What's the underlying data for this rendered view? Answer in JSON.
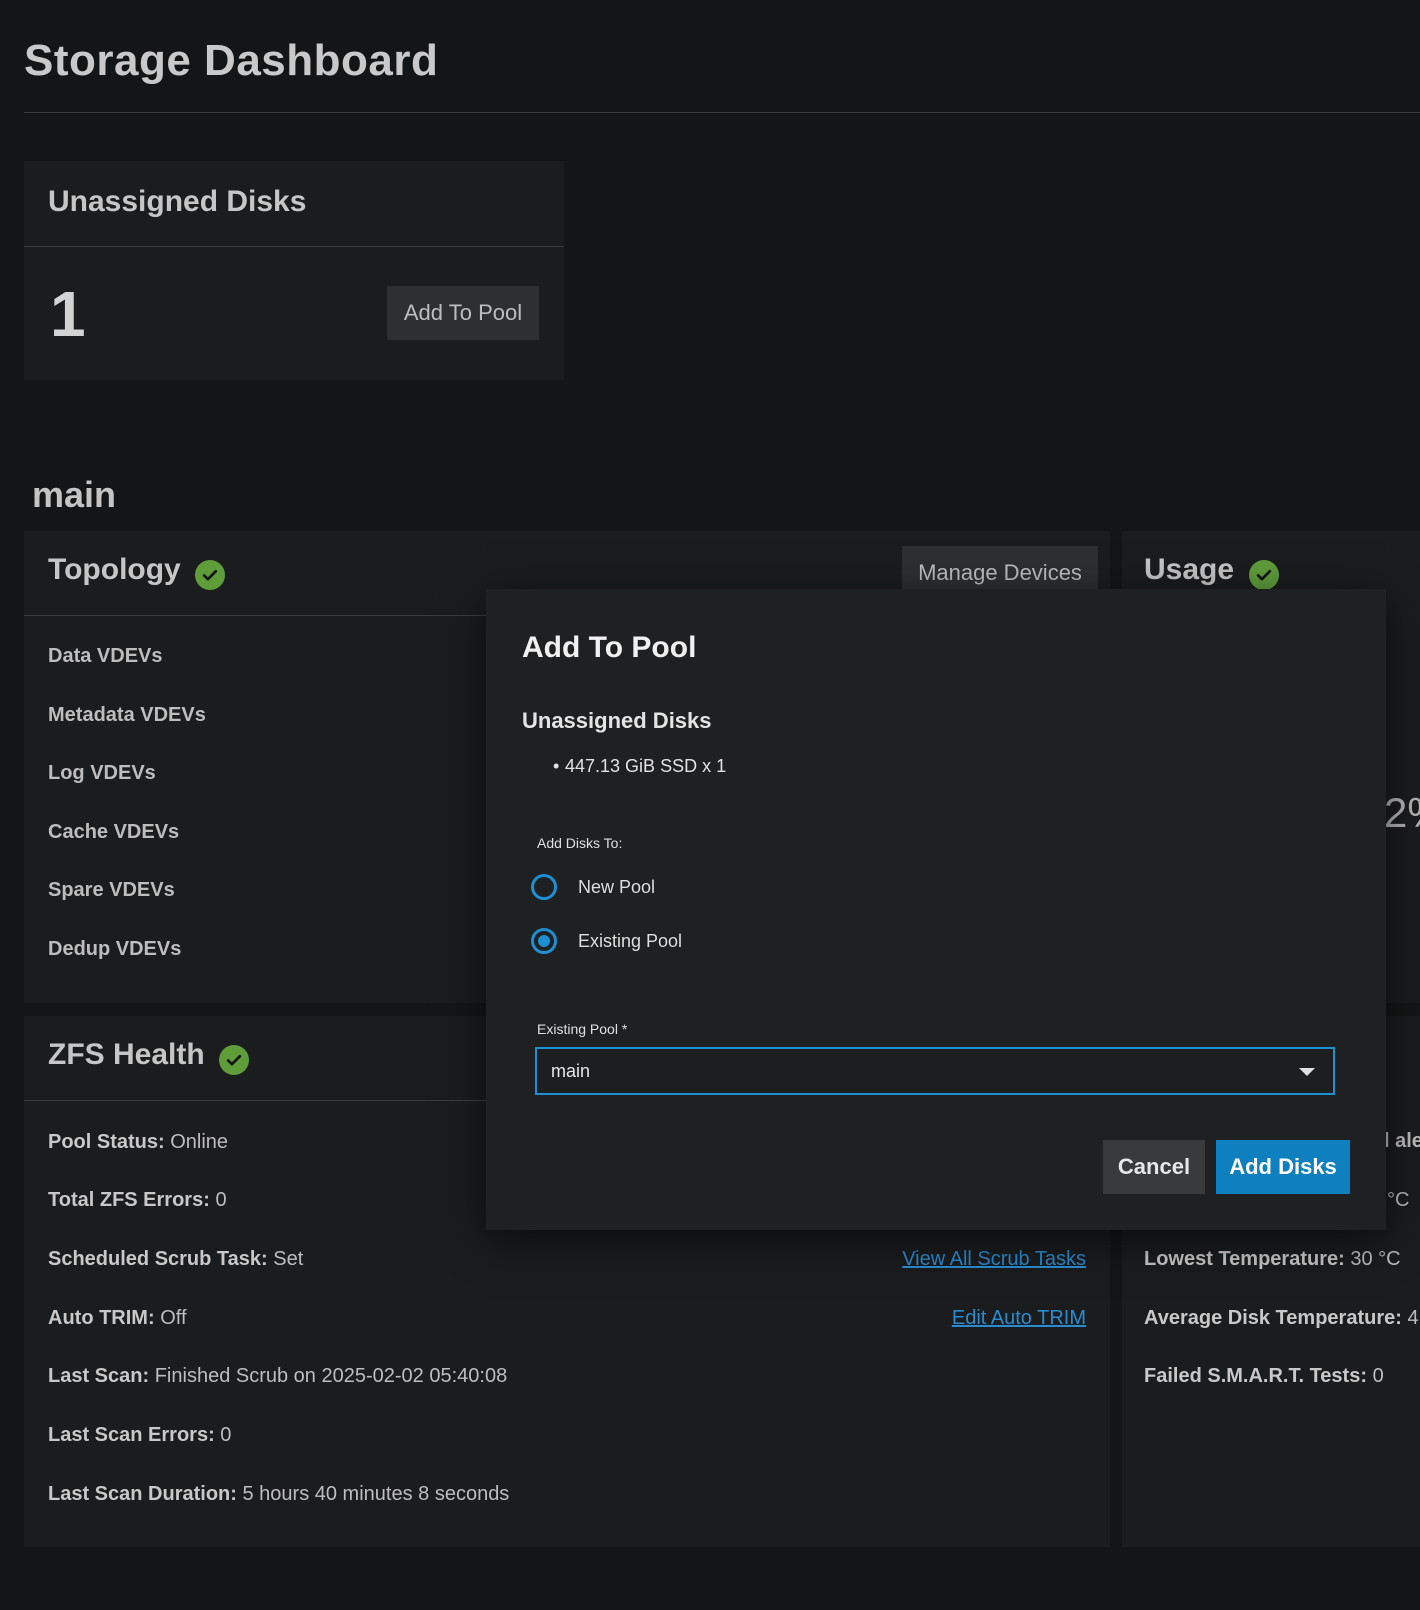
{
  "page": {
    "title": "Storage Dashboard"
  },
  "unassigned": {
    "title": "Unassigned Disks",
    "count": "1",
    "add_button": "Add To Pool"
  },
  "pool": {
    "name": "main"
  },
  "topology": {
    "title": "Topology",
    "manage_button": "Manage Devices",
    "rows": [
      "Data VDEVs",
      "Metadata VDEVs",
      "Log VDEVs",
      "Cache VDEVs",
      "Spare VDEVs",
      "Dedup VDEVs"
    ]
  },
  "usage": {
    "title": "Usage",
    "partial_value": "2%"
  },
  "zfs_health": {
    "title": "ZFS Health",
    "rows": [
      {
        "label": "Pool Status:",
        "value": "Online"
      },
      {
        "label": "Total ZFS Errors:",
        "value": "0"
      },
      {
        "label": "Scheduled Scrub Task:",
        "value": "Set"
      },
      {
        "label": "Auto TRIM:",
        "value": "Off"
      },
      {
        "label": "Last Scan:",
        "value": "Finished Scrub on 2025-02-02 05:40:08"
      },
      {
        "label": "Last Scan Errors:",
        "value": "0"
      },
      {
        "label": "Last Scan Duration:",
        "value": "5 hours 40 minutes 8 seconds"
      }
    ],
    "view_scrub_link": "View All Scrub Tasks",
    "edit_trim_link": "Edit Auto TRIM"
  },
  "disk_health": {
    "partial_alerts": "l ale",
    "partial_temp_high": "°C",
    "rows": [
      {
        "label": "Lowest Temperature:",
        "value": "30 °C"
      },
      {
        "label": "Average Disk Temperature:",
        "value": "4"
      },
      {
        "label": "Failed S.M.A.R.T. Tests:",
        "value": "0"
      }
    ]
  },
  "dialog": {
    "title": "Add To Pool",
    "section_title": "Unassigned Disks",
    "disks": [
      "447.13 GiB SSD x 1"
    ],
    "add_to_label": "Add Disks To:",
    "options": [
      {
        "label": "New Pool",
        "selected": false
      },
      {
        "label": "Existing Pool",
        "selected": true
      }
    ],
    "select_label": "Existing Pool *",
    "select_value": "main",
    "cancel_button": "Cancel",
    "confirm_button": "Add Disks"
  },
  "colors": {
    "accent": "#0f80bf",
    "success": "#5f9d3b",
    "link": "#2a8cd0"
  }
}
